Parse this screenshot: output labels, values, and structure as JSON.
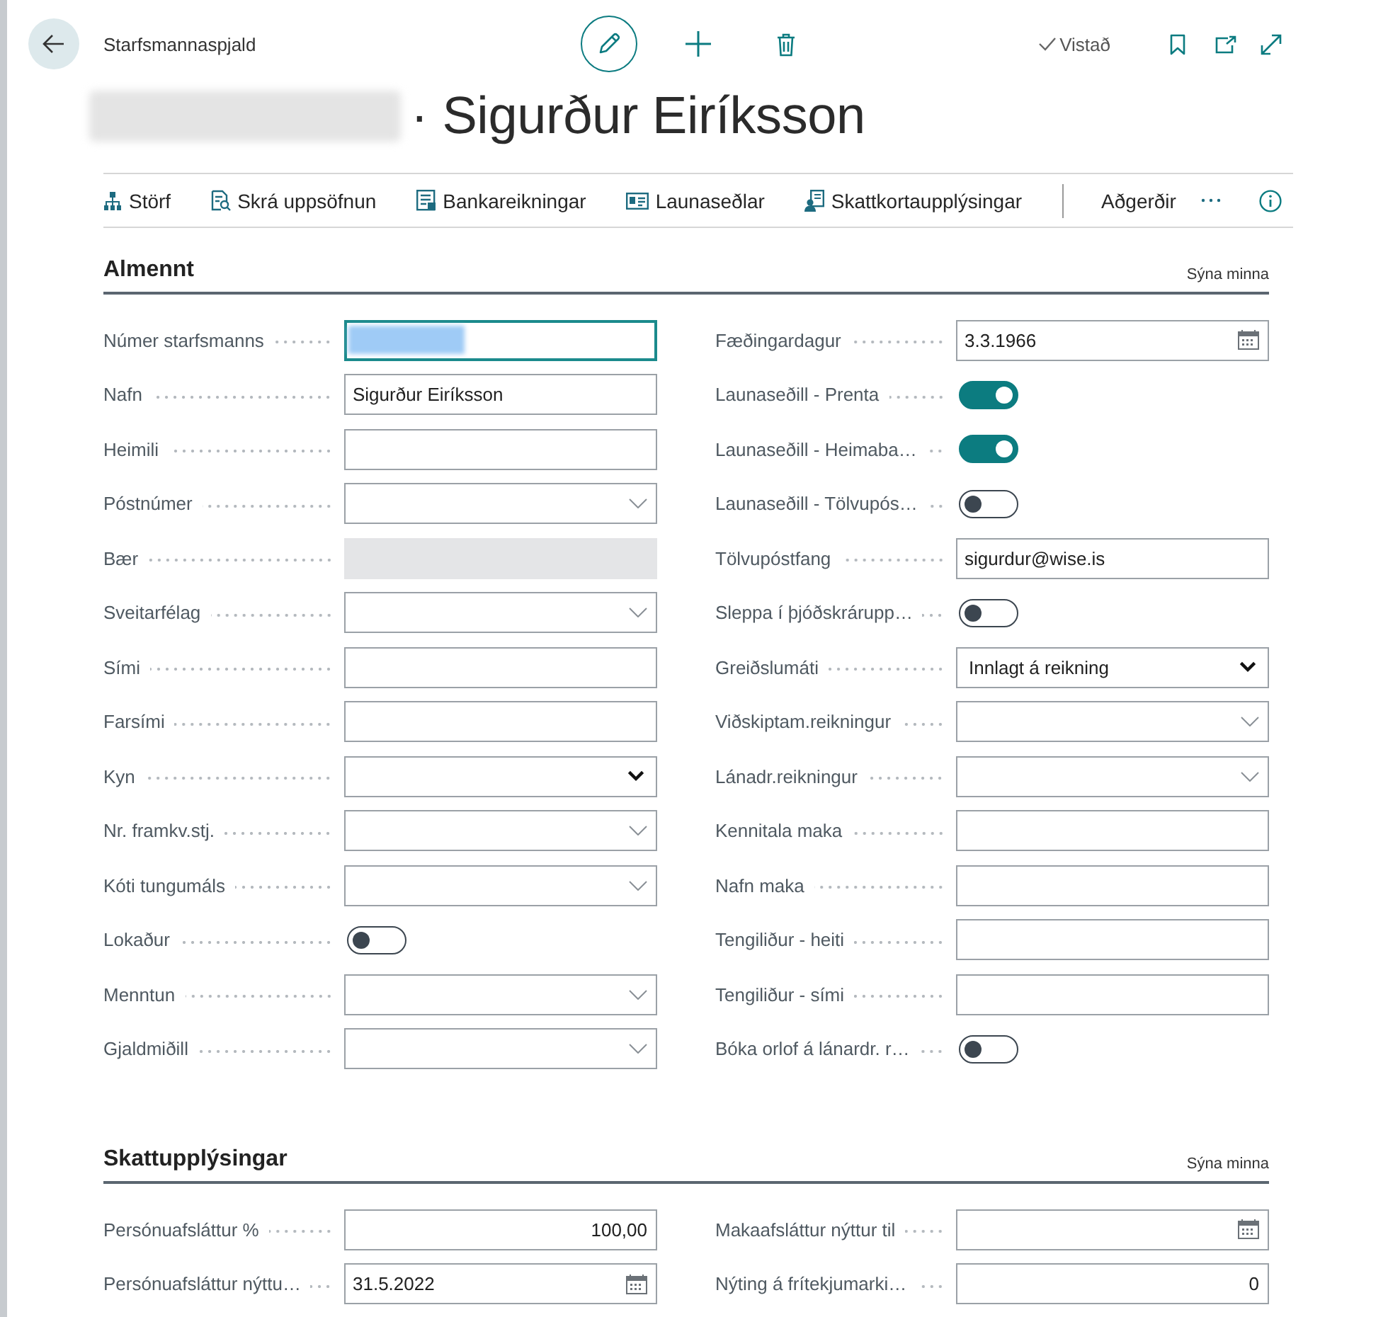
{
  "header": {
    "breadcrumb": "Starfsmannaspjald",
    "save_status": "Vistað"
  },
  "title": {
    "prefix_redacted": true,
    "text": "· Sigurður Eiríksson"
  },
  "actions": [
    {
      "label": "Störf"
    },
    {
      "label": "Skrá uppsöfnun"
    },
    {
      "label": "Bankareikningar"
    },
    {
      "label": "Launaseðlar"
    },
    {
      "label": "Skattkortaupplýsingar"
    }
  ],
  "actions_menu": {
    "label": "Aðgerðir"
  },
  "sections": [
    {
      "title": "Almennt",
      "toggle_label": "Sýna minna",
      "columns": [
        [
          {
            "label": "Númer starfsmanns",
            "kind": "redacted",
            "focused": true
          },
          {
            "label": "Nafn",
            "kind": "text",
            "value": "Sigurður Eiríksson",
            "focused": false
          },
          {
            "label": "Heimili",
            "kind": "text",
            "focused": false
          },
          {
            "label": "Póstnúmer",
            "kind": "lookup",
            "focused": false
          },
          {
            "label": "Bær",
            "kind": "readonly",
            "focused": false
          },
          {
            "label": "Sveitarfélag",
            "kind": "lookup",
            "focused": false
          },
          {
            "label": "Sími",
            "kind": "text",
            "focused": false
          },
          {
            "label": "Farsími",
            "kind": "text",
            "focused": false
          },
          {
            "label": "Kyn",
            "kind": "option",
            "focused": false
          },
          {
            "label": "Nr. framkv.stj.",
            "kind": "lookup",
            "focused": false
          },
          {
            "label": "Kóti tungumáls",
            "kind": "lookup",
            "focused": false
          },
          {
            "label": "Lokaður",
            "kind": "toggle",
            "on": false
          },
          {
            "label": "Menntun",
            "kind": "lookup",
            "focused": false
          },
          {
            "label": "Gjaldmiðill",
            "kind": "lookup",
            "focused": false
          }
        ],
        [
          {
            "label": "Fæðingardagur",
            "kind": "date",
            "value": "3.3.1966",
            "focused": false
          },
          {
            "label": "Launaseðill - Prenta",
            "kind": "toggle",
            "on": true
          },
          {
            "label": "Launaseðill - Heimaba…",
            "kind": "toggle",
            "on": true
          },
          {
            "label": "Launaseðill - Tölvupós…",
            "kind": "toggle",
            "on": false
          },
          {
            "label": "Tölvupóstfang",
            "kind": "text",
            "value": "sigurdur@wise.is",
            "focused": false
          },
          {
            "label": "Sleppa í þjóðskrárupp…",
            "kind": "toggle",
            "on": false
          },
          {
            "label": "Greiðslumáti",
            "kind": "option",
            "value": "Innlagt á reikning",
            "focused": false
          },
          {
            "label": "Viðskiptam.reikningur",
            "kind": "lookup",
            "focused": false
          },
          {
            "label": "Lánadr.reikningur",
            "kind": "lookup",
            "focused": false
          },
          {
            "label": "Kennitala maka",
            "kind": "text",
            "focused": false
          },
          {
            "label": "Nafn maka",
            "kind": "text",
            "focused": false
          },
          {
            "label": "Tengiliður - heiti",
            "kind": "text",
            "focused": false
          },
          {
            "label": "Tengiliður - sími",
            "kind": "text",
            "focused": false
          },
          {
            "label": "Bóka orlof á lánardr. r…",
            "kind": "toggle",
            "on": false
          }
        ]
      ]
    },
    {
      "title": "Skattupplýsingar",
      "toggle_label": "Sýna minna",
      "columns": [
        [
          {
            "label": "Persónuafsláttur %",
            "kind": "number",
            "value": "100,00",
            "focused": false
          },
          {
            "label": "Persónuafsláttur nýttu…",
            "kind": "date",
            "value": "31.5.2022",
            "focused": false
          }
        ],
        [
          {
            "label": "Makaafsláttur nýttur til",
            "kind": "date",
            "focused": false
          },
          {
            "label": "Nýting á frítekjumarki…",
            "kind": "number",
            "value": "0",
            "focused": false
          }
        ]
      ]
    }
  ]
}
